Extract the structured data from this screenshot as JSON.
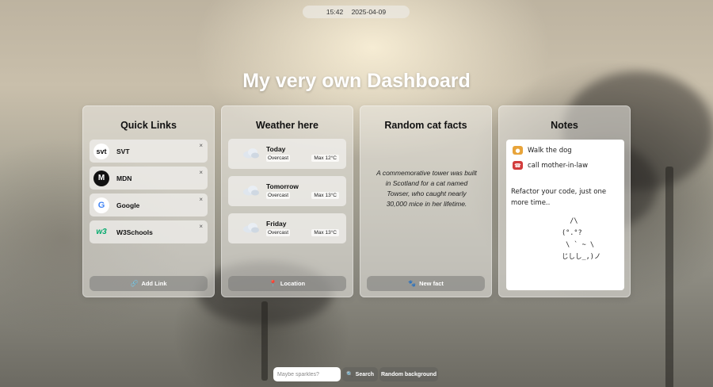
{
  "clock": {
    "time": "15:42",
    "date": "2025-04-09"
  },
  "page_title": "My very own Dashboard",
  "quick_links": {
    "title": "Quick Links",
    "items": [
      {
        "label": "SVT",
        "logo_text": "svt",
        "close": "×"
      },
      {
        "label": "MDN",
        "logo_text": "M",
        "close": "×"
      },
      {
        "label": "Google",
        "logo_text": "G",
        "close": "×"
      },
      {
        "label": "W3Schools",
        "logo_text": "w3",
        "close": "×"
      }
    ],
    "add_button": "Add Link"
  },
  "weather": {
    "title": "Weather here",
    "days": [
      {
        "day": "Today",
        "condition": "Overcast",
        "max": "Max 12°C"
      },
      {
        "day": "Tomorrow",
        "condition": "Overcast",
        "max": "Max 13°C"
      },
      {
        "day": "Friday",
        "condition": "Overcast",
        "max": "Max 13°C"
      }
    ],
    "location_button": "Location"
  },
  "cat_facts": {
    "title": "Random cat facts",
    "fact": "A commemorative tower was built in Scotland for a cat named Towser, who caught nearly 30,000 mice in her lifetime.",
    "new_button": "New fact"
  },
  "notes": {
    "title": "Notes",
    "line1": "Walk the dog",
    "line2": "call mother-in-law",
    "paragraph": "Refactor your code, just one more time..",
    "art": "  /\\\n(°.°?\n \\ ` ~ \\\nじしし_,)ノ"
  },
  "bottom_bar": {
    "search_placeholder": "Maybe sparkles?",
    "search_button": "Search",
    "random_button": "Random background"
  },
  "colors": {
    "card_bg": "#ebe9e4",
    "button_bg": "#787876",
    "title_color": "#ffffff"
  }
}
